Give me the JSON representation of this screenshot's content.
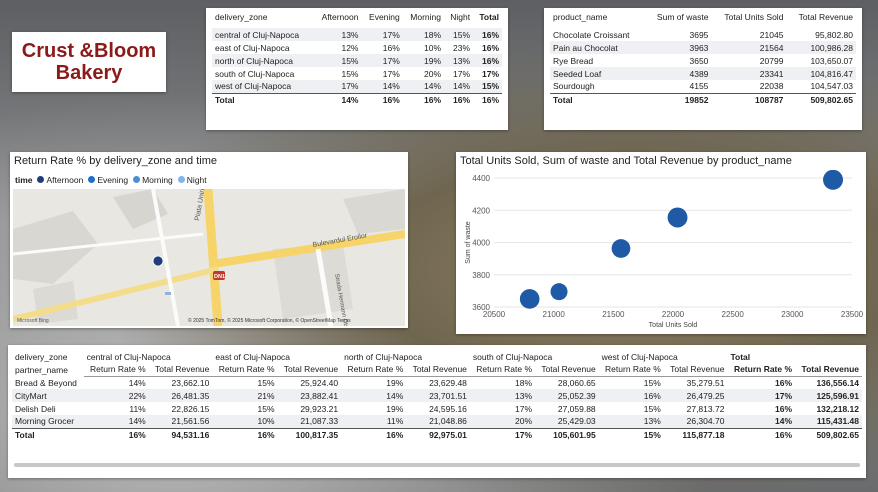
{
  "app": {
    "title_line1": "Crust &Bloom",
    "title_line2": "Bakery"
  },
  "zone_table": {
    "headers": [
      "delivery_zone",
      "Afternoon",
      "Evening",
      "Morning",
      "Night",
      "Total"
    ],
    "rows": [
      [
        "central of Cluj-Napoca",
        "13%",
        "17%",
        "18%",
        "15%",
        "16%"
      ],
      [
        "east of Cluj-Napoca",
        "12%",
        "16%",
        "10%",
        "23%",
        "16%"
      ],
      [
        "north of Cluj-Napoca",
        "15%",
        "17%",
        "19%",
        "13%",
        "16%"
      ],
      [
        "south of Cluj-Napoca",
        "15%",
        "17%",
        "20%",
        "17%",
        "17%"
      ],
      [
        "west of Cluj-Napoca",
        "17%",
        "14%",
        "14%",
        "14%",
        "15%"
      ]
    ],
    "total": [
      "Total",
      "14%",
      "16%",
      "16%",
      "16%",
      "16%"
    ]
  },
  "product_table": {
    "headers": [
      "product_name",
      "Sum of waste",
      "Total Units Sold",
      "Total Revenue"
    ],
    "rows": [
      [
        "Chocolate Croissant",
        "3695",
        "21045",
        "95,802.80"
      ],
      [
        "Pain au Chocolat",
        "3963",
        "21564",
        "100,986.28"
      ],
      [
        "Rye Bread",
        "3650",
        "20799",
        "103,650.07"
      ],
      [
        "Seeded Loaf",
        "4389",
        "23341",
        "104,816.47"
      ],
      [
        "Sourdough",
        "4155",
        "22038",
        "104,547.03"
      ]
    ],
    "total": [
      "Total",
      "19852",
      "108787",
      "509,802.65"
    ]
  },
  "map": {
    "title": "Return Rate % by delivery_zone and time",
    "legend_title": "time",
    "legend": [
      {
        "label": "Afternoon",
        "color": "#1f3d7a"
      },
      {
        "label": "Evening",
        "color": "#1f6fc4"
      },
      {
        "label": "Morning",
        "color": "#4a90d9"
      },
      {
        "label": "Night",
        "color": "#7fb5e8"
      }
    ],
    "streets": [
      "Piata Unirii",
      "Bulevardul Eroilor",
      "Strada Hermann Oberth"
    ],
    "credit": "© 2025 TomTom, © 2025 Microsoft Corporation, © OpenStreetMap Terms",
    "bing_label": "Microsoft Bing",
    "marker_label": "DN1"
  },
  "chart_data": {
    "type": "scatter",
    "title": "Total Units Sold, Sum of waste and Total Revenue by product_name",
    "xlabel": "Total Units Sold",
    "ylabel": "Sum of waste",
    "xlim": [
      20500,
      23500
    ],
    "ylim": [
      3600,
      4400
    ],
    "xticks": [
      20500,
      21000,
      21500,
      22000,
      22500,
      23000,
      23500
    ],
    "yticks": [
      3600,
      3800,
      4000,
      4200,
      4400
    ],
    "points": [
      {
        "name": "Rye Bread",
        "x": 20799,
        "y": 3650,
        "size": 103650.07
      },
      {
        "name": "Chocolate Croissant",
        "x": 21045,
        "y": 3695,
        "size": 95802.8
      },
      {
        "name": "Pain au Chocolat",
        "x": 21564,
        "y": 3963,
        "size": 100986.28
      },
      {
        "name": "Sourdough",
        "x": 22038,
        "y": 4155,
        "size": 104547.03
      },
      {
        "name": "Seeded Loaf",
        "x": 23341,
        "y": 4389,
        "size": 104816.47
      }
    ],
    "color": "#1f5aa6"
  },
  "matrix": {
    "row_header_1": "delivery_zone",
    "row_header_2": "partner_name",
    "zones": [
      "central of Cluj-Napoca",
      "east of Cluj-Napoca",
      "north of Cluj-Napoca",
      "south of Cluj-Napoca",
      "west of Cluj-Napoca",
      "Total"
    ],
    "measures": [
      "Return Rate %",
      "Total Revenue"
    ],
    "rows": [
      {
        "name": "Bread & Beyond",
        "values": [
          "14%",
          "23,662.10",
          "15%",
          "25,924.40",
          "19%",
          "23,629.48",
          "18%",
          "28,060.65",
          "15%",
          "35,279.51",
          "16%",
          "136,556.14"
        ]
      },
      {
        "name": "CityMart",
        "values": [
          "22%",
          "26,481.35",
          "21%",
          "23,882.41",
          "14%",
          "23,701.51",
          "13%",
          "25,052.39",
          "16%",
          "26,479.25",
          "17%",
          "125,596.91"
        ]
      },
      {
        "name": "Delish Deli",
        "values": [
          "11%",
          "22,826.15",
          "15%",
          "29,923.21",
          "19%",
          "24,595.16",
          "17%",
          "27,059.88",
          "15%",
          "27,813.72",
          "16%",
          "132,218.12"
        ]
      },
      {
        "name": "Morning Grocer",
        "values": [
          "14%",
          "21,561.56",
          "10%",
          "21,087.33",
          "11%",
          "21,048.86",
          "20%",
          "25,429.03",
          "13%",
          "26,304.70",
          "14%",
          "115,431.48"
        ]
      }
    ],
    "total": {
      "name": "Total",
      "values": [
        "16%",
        "94,531.16",
        "16%",
        "100,817.35",
        "16%",
        "92,975.01",
        "17%",
        "105,601.95",
        "15%",
        "115,877.18",
        "16%",
        "509,802.65"
      ]
    }
  }
}
